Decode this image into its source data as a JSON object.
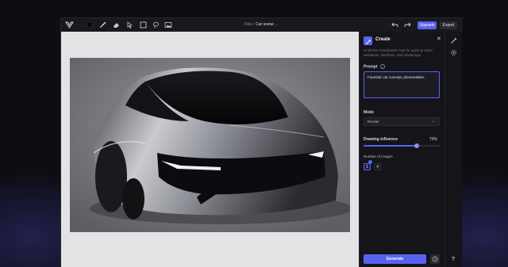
{
  "toolbar": {
    "breadcrumb_parent": "Files",
    "breadcrumb_sep": "/",
    "breadcrumb_current": "Car scene",
    "upgrade_label": "Upgrade",
    "export_label": "Export"
  },
  "panel": {
    "title": "Create",
    "description": "AI-driven visualization tool for quick product variations, sketches, and renderings.",
    "prompt_label": "Prompt",
    "prompt_value": "Futuristic car concept, photorealistic",
    "mode_label": "Mode",
    "mode_value": "Render",
    "influence_label": "Drawing influence",
    "influence_value": "70%",
    "influence_fraction": 0.7,
    "images_label": "Number of images",
    "images_option_1": "1",
    "images_option_2": "4",
    "generate_label": "Generate"
  },
  "rail": {
    "help_label": "?"
  },
  "colors": {
    "accent": "#5862f0",
    "background": "#0d0d12",
    "canvas": "#e3e3e6"
  }
}
